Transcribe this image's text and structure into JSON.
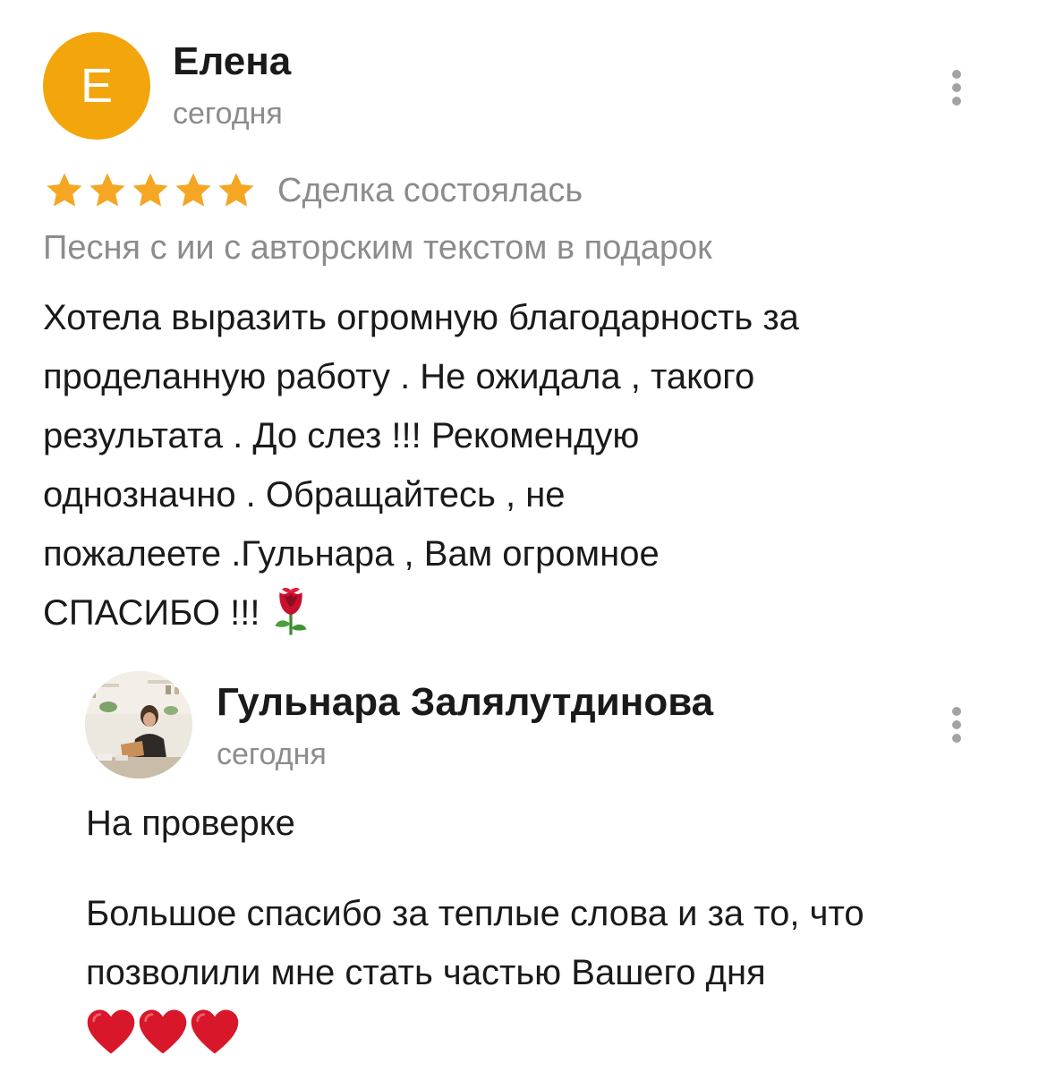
{
  "review": {
    "avatar_letter": "Е",
    "author_name": "Елена",
    "date": "сегодня",
    "rating": 5,
    "deal_status": "Сделка состоялась",
    "service_title": "Песня с ии с авторским текстом в подарок",
    "text_lines": [
      "Хотела выразить огромную благодарность за",
      "проделанную работу . Не ожидала , такого",
      "результата . До слез !!! Рекомендую",
      "однозначно . Обращайтесь , не",
      "пожалеете .Гульнара , Вам огромное",
      "СПАСИБО !!!"
    ],
    "emoji": "rose"
  },
  "reply": {
    "author_name": "Гульнара Залялутдинова",
    "date": "сегодня",
    "status": "На проверке",
    "text_lines": [
      "Большое спасибо за теплые слова и за то, что",
      "позволили мне стать частью Вашего дня"
    ],
    "emoji": "red-heart",
    "emoji_count": 3
  },
  "colors": {
    "avatar_bg": "#f3a50c",
    "star": "#f5a623",
    "muted_text": "#8c8c8c",
    "kebab": "#a3a3a3"
  },
  "icons": {
    "menu": "more-vertical-icon",
    "star": "star-icon"
  }
}
